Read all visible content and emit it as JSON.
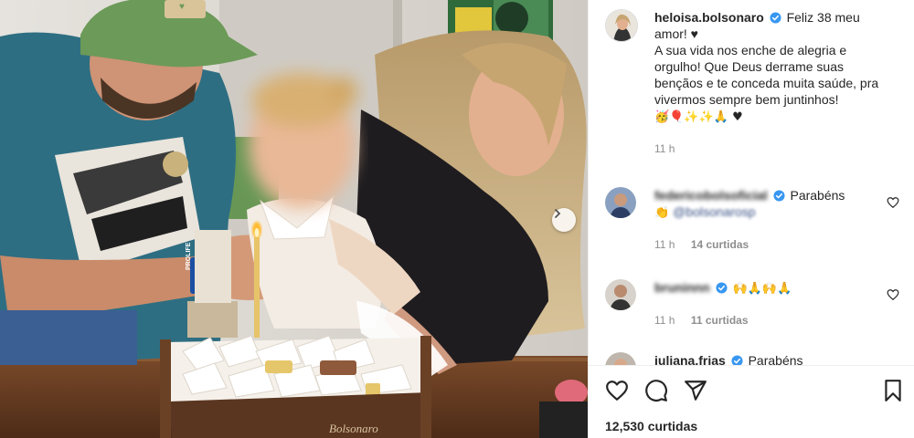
{
  "post": {
    "username": "heloisa.bolsonaro",
    "caption_line1": "Feliz 38 meu amor! ♥",
    "caption_line2": "A sua vida nos enche de alegria e orgulho! Que Deus derrame suas bençãos e te conceda muita saúde, pra vivermos sempre bem juntinhos!",
    "caption_emojis": "🥳🎈✨✨🙏 ♥",
    "time": "11 h",
    "likes": "12,530 curtidas"
  },
  "comments": [
    {
      "username": "federicobolsoficial",
      "text": "Parabéns",
      "emoji": "👏",
      "mention": "@bolsonarosp",
      "time": "11 h",
      "likes": "14 curtidas"
    },
    {
      "username": "bruninnn",
      "text": "",
      "emoji": "🙌🙏🙌🙏",
      "time": "11 h",
      "likes": "11 curtidas"
    },
    {
      "username": "juliana.frias",
      "text": "Parabéns",
      "emoji": "",
      "time": "",
      "likes": ""
    }
  ],
  "photo": {
    "cap_patch": "♥",
    "wristband": "PROLIFE",
    "box_label": "Bolsonaro"
  },
  "colors": {
    "verified": "#3897f0",
    "mention": "#385185",
    "muted": "#8e8e8e"
  },
  "icons": [
    "chevron-right-icon",
    "verified-badge-icon",
    "heart-icon",
    "comment-icon",
    "share-icon",
    "bookmark-icon"
  ]
}
